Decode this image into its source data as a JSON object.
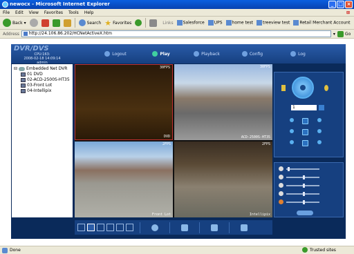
{
  "window": {
    "title": "newocx - Microsoft Internet Explorer",
    "minimize": "_",
    "maximize": "□",
    "close": "×"
  },
  "menu": [
    "File",
    "Edit",
    "View",
    "Favorites",
    "Tools",
    "Help"
  ],
  "toolbar": {
    "back": "Back",
    "search": "Search",
    "favorites": "Favorites",
    "links_label": "Links",
    "links": [
      "Salesforce",
      "UPS",
      "home test",
      "treeview test",
      "Retail Merchant Account"
    ]
  },
  "address": {
    "label": "Address",
    "url": "http://24.106.86.202/HCNetActiveX.htm",
    "go": "Go"
  },
  "dvr": {
    "title": "DVR/DVS",
    "cpu": "CPU:163:",
    "datetime": "2008-02-18 14:09:14",
    "user": "admin",
    "tabs": [
      "Logout",
      "Play",
      "Playback",
      "Config",
      "Log"
    ],
    "active_tab": "Play"
  },
  "tree": {
    "root": "Embedded Net DVR",
    "cameras": [
      "01 DVD",
      "02-ACD-2500S-HT35",
      "03-Front Lot",
      "04-Intellipix"
    ]
  },
  "video": [
    {
      "fps": "30FPS",
      "caption": "DVD"
    },
    {
      "fps": "30FPS",
      "caption": "ACD-2500S-HT35"
    },
    {
      "fps": "2FPS",
      "caption": "Front Lot"
    },
    {
      "fps": "2FPS",
      "caption": "Intellipix"
    }
  ],
  "ptz": {
    "speed": "1"
  }
}
